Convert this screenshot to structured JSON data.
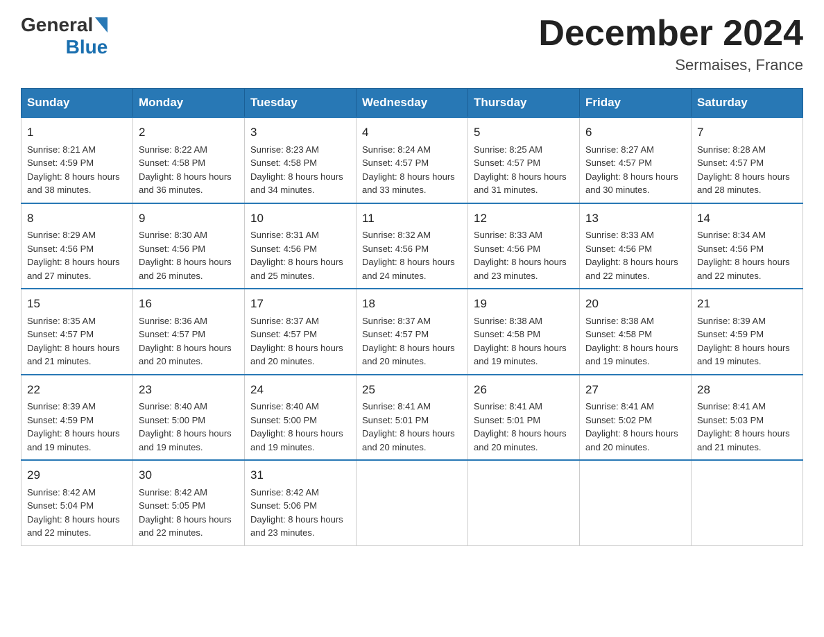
{
  "header": {
    "logo_general": "General",
    "logo_blue": "Blue",
    "month_title": "December 2024",
    "location": "Sermaises, France"
  },
  "days_of_week": [
    "Sunday",
    "Monday",
    "Tuesday",
    "Wednesday",
    "Thursday",
    "Friday",
    "Saturday"
  ],
  "weeks": [
    [
      {
        "day": "1",
        "sunrise": "8:21 AM",
        "sunset": "4:59 PM",
        "daylight": "8 hours and 38 minutes."
      },
      {
        "day": "2",
        "sunrise": "8:22 AM",
        "sunset": "4:58 PM",
        "daylight": "8 hours and 36 minutes."
      },
      {
        "day": "3",
        "sunrise": "8:23 AM",
        "sunset": "4:58 PM",
        "daylight": "8 hours and 34 minutes."
      },
      {
        "day": "4",
        "sunrise": "8:24 AM",
        "sunset": "4:57 PM",
        "daylight": "8 hours and 33 minutes."
      },
      {
        "day": "5",
        "sunrise": "8:25 AM",
        "sunset": "4:57 PM",
        "daylight": "8 hours and 31 minutes."
      },
      {
        "day": "6",
        "sunrise": "8:27 AM",
        "sunset": "4:57 PM",
        "daylight": "8 hours and 30 minutes."
      },
      {
        "day": "7",
        "sunrise": "8:28 AM",
        "sunset": "4:57 PM",
        "daylight": "8 hours and 28 minutes."
      }
    ],
    [
      {
        "day": "8",
        "sunrise": "8:29 AM",
        "sunset": "4:56 PM",
        "daylight": "8 hours and 27 minutes."
      },
      {
        "day": "9",
        "sunrise": "8:30 AM",
        "sunset": "4:56 PM",
        "daylight": "8 hours and 26 minutes."
      },
      {
        "day": "10",
        "sunrise": "8:31 AM",
        "sunset": "4:56 PM",
        "daylight": "8 hours and 25 minutes."
      },
      {
        "day": "11",
        "sunrise": "8:32 AM",
        "sunset": "4:56 PM",
        "daylight": "8 hours and 24 minutes."
      },
      {
        "day": "12",
        "sunrise": "8:33 AM",
        "sunset": "4:56 PM",
        "daylight": "8 hours and 23 minutes."
      },
      {
        "day": "13",
        "sunrise": "8:33 AM",
        "sunset": "4:56 PM",
        "daylight": "8 hours and 22 minutes."
      },
      {
        "day": "14",
        "sunrise": "8:34 AM",
        "sunset": "4:56 PM",
        "daylight": "8 hours and 22 minutes."
      }
    ],
    [
      {
        "day": "15",
        "sunrise": "8:35 AM",
        "sunset": "4:57 PM",
        "daylight": "8 hours and 21 minutes."
      },
      {
        "day": "16",
        "sunrise": "8:36 AM",
        "sunset": "4:57 PM",
        "daylight": "8 hours and 20 minutes."
      },
      {
        "day": "17",
        "sunrise": "8:37 AM",
        "sunset": "4:57 PM",
        "daylight": "8 hours and 20 minutes."
      },
      {
        "day": "18",
        "sunrise": "8:37 AM",
        "sunset": "4:57 PM",
        "daylight": "8 hours and 20 minutes."
      },
      {
        "day": "19",
        "sunrise": "8:38 AM",
        "sunset": "4:58 PM",
        "daylight": "8 hours and 19 minutes."
      },
      {
        "day": "20",
        "sunrise": "8:38 AM",
        "sunset": "4:58 PM",
        "daylight": "8 hours and 19 minutes."
      },
      {
        "day": "21",
        "sunrise": "8:39 AM",
        "sunset": "4:59 PM",
        "daylight": "8 hours and 19 minutes."
      }
    ],
    [
      {
        "day": "22",
        "sunrise": "8:39 AM",
        "sunset": "4:59 PM",
        "daylight": "8 hours and 19 minutes."
      },
      {
        "day": "23",
        "sunrise": "8:40 AM",
        "sunset": "5:00 PM",
        "daylight": "8 hours and 19 minutes."
      },
      {
        "day": "24",
        "sunrise": "8:40 AM",
        "sunset": "5:00 PM",
        "daylight": "8 hours and 19 minutes."
      },
      {
        "day": "25",
        "sunrise": "8:41 AM",
        "sunset": "5:01 PM",
        "daylight": "8 hours and 20 minutes."
      },
      {
        "day": "26",
        "sunrise": "8:41 AM",
        "sunset": "5:01 PM",
        "daylight": "8 hours and 20 minutes."
      },
      {
        "day": "27",
        "sunrise": "8:41 AM",
        "sunset": "5:02 PM",
        "daylight": "8 hours and 20 minutes."
      },
      {
        "day": "28",
        "sunrise": "8:41 AM",
        "sunset": "5:03 PM",
        "daylight": "8 hours and 21 minutes."
      }
    ],
    [
      {
        "day": "29",
        "sunrise": "8:42 AM",
        "sunset": "5:04 PM",
        "daylight": "8 hours and 22 minutes."
      },
      {
        "day": "30",
        "sunrise": "8:42 AM",
        "sunset": "5:05 PM",
        "daylight": "8 hours and 22 minutes."
      },
      {
        "day": "31",
        "sunrise": "8:42 AM",
        "sunset": "5:06 PM",
        "daylight": "8 hours and 23 minutes."
      },
      null,
      null,
      null,
      null
    ]
  ],
  "labels": {
    "sunrise": "Sunrise:",
    "sunset": "Sunset:",
    "daylight": "Daylight:"
  }
}
